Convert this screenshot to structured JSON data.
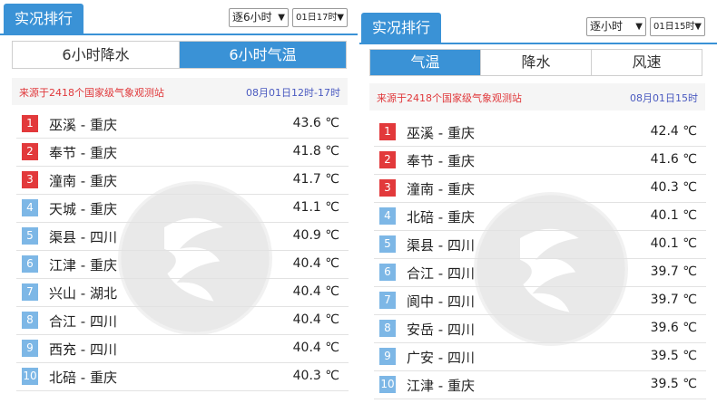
{
  "left": {
    "title": "实况排行",
    "select_interval": "逐6小时",
    "select_time": "01日17时",
    "tabs": [
      {
        "label": "6小时降水",
        "active": false
      },
      {
        "label": "6小时气温",
        "active": true
      }
    ],
    "source": "来源于2418个国家级气象观测站",
    "time_range": "08月01日12时-17时",
    "rows": [
      {
        "rank": "1",
        "name": "巫溪 - 重庆",
        "value": "43.6 ℃"
      },
      {
        "rank": "2",
        "name": "奉节 - 重庆",
        "value": "41.8 ℃"
      },
      {
        "rank": "3",
        "name": "潼南 - 重庆",
        "value": "41.7 ℃"
      },
      {
        "rank": "4",
        "name": "天城 - 重庆",
        "value": "41.1 ℃"
      },
      {
        "rank": "5",
        "name": "渠县 - 四川",
        "value": "40.9 ℃"
      },
      {
        "rank": "6",
        "name": "江津 - 重庆",
        "value": "40.4 ℃"
      },
      {
        "rank": "7",
        "name": "兴山 - 湖北",
        "value": "40.4 ℃"
      },
      {
        "rank": "8",
        "name": "合江 - 四川",
        "value": "40.4 ℃"
      },
      {
        "rank": "9",
        "name": "西充 - 四川",
        "value": "40.4 ℃"
      },
      {
        "rank": "10",
        "name": "北碚 - 重庆",
        "value": "40.3 ℃"
      }
    ]
  },
  "right": {
    "title": "实况排行",
    "select_interval": "逐小时",
    "select_time": "01日15时",
    "tabs": [
      {
        "label": "气温",
        "active": true
      },
      {
        "label": "降水",
        "active": false
      },
      {
        "label": "风速",
        "active": false
      }
    ],
    "source": "来源于2418个国家级气象观测站",
    "time_range": "08月01日15时",
    "rows": [
      {
        "rank": "1",
        "name": "巫溪 - 重庆",
        "value": "42.4 ℃"
      },
      {
        "rank": "2",
        "name": "奉节 - 重庆",
        "value": "41.6 ℃"
      },
      {
        "rank": "3",
        "name": "潼南 - 重庆",
        "value": "40.3 ℃"
      },
      {
        "rank": "4",
        "name": "北碚 - 重庆",
        "value": "40.1 ℃"
      },
      {
        "rank": "5",
        "name": "渠县 - 四川",
        "value": "40.1 ℃"
      },
      {
        "rank": "6",
        "name": "合江 - 四川",
        "value": "39.7 ℃"
      },
      {
        "rank": "7",
        "name": "阆中 - 四川",
        "value": "39.7 ℃"
      },
      {
        "rank": "8",
        "name": "安岳 - 四川",
        "value": "39.6 ℃"
      },
      {
        "rank": "9",
        "name": "广安 - 四川",
        "value": "39.5 ℃"
      },
      {
        "rank": "10",
        "name": "江津 - 重庆",
        "value": "39.5 ℃"
      }
    ]
  },
  "colors": {
    "accent": "#3a92d6",
    "rank_top": "#e2393b",
    "rank_other": "#7db7e6",
    "source_text": "#e0383b",
    "time_text": "#4a5ac0"
  },
  "icons": {
    "watermark": "cma-logo-watermark-icon",
    "dropdown": "chevron-down-icon"
  }
}
